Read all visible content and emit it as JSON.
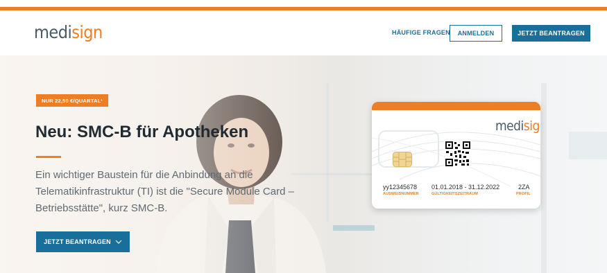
{
  "brand": {
    "logo_part1": "medi",
    "logo_part2": "sign",
    "orange": "#ef7d22",
    "blue": "#1a6f9a"
  },
  "nav": {
    "faq_label": "HÄUFIGE FRAGEN",
    "login_label": "ANMELDEN",
    "apply_label": "JETZT BEANTRAGEN"
  },
  "hero": {
    "badge": "NUR 22,50 €/QUARTAL¹",
    "headline": "Neu: SMC-B für Apotheken",
    "lead": "Ein wichtiger Baustein für die Anbindung an die Telematikinfrastruktur (TI) ist die \"Secure Module Card – Betriebsstätte\", kurz SMC-B.",
    "cta_label": "JETZT BEANTRAGEN",
    "cta_icon": "chevron-down-icon"
  },
  "card": {
    "logo_part1": "medi",
    "logo_part2": "sign",
    "id_value": "yy12345678",
    "id_label": "AUSWEISNUMMER",
    "validity_value": "01.01.2018 - 31.12.2022",
    "validity_label": "GÜLTIGKEITSZEITRAUM",
    "profile_value": "2ZA",
    "profile_label": "PROFIL"
  }
}
